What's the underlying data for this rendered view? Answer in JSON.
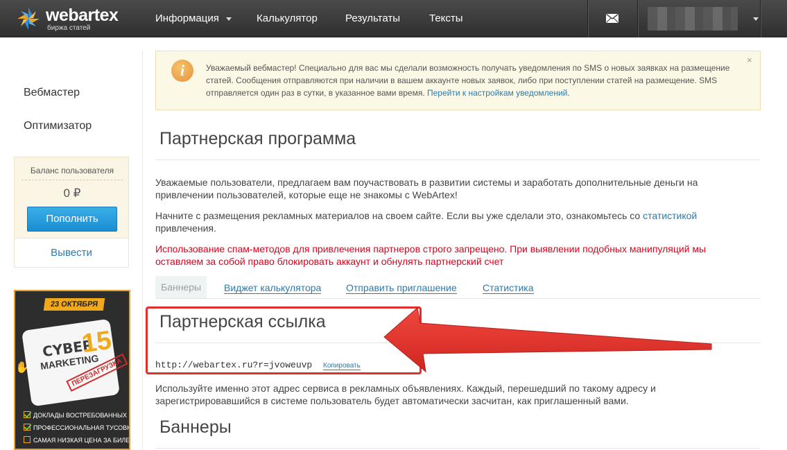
{
  "logo": {
    "name": "webartex",
    "tagline": "биржа статей"
  },
  "nav": {
    "items": [
      {
        "label": "Информация",
        "has_dropdown": true
      },
      {
        "label": "Калькулятор"
      },
      {
        "label": "Результаты"
      },
      {
        "label": "Тексты"
      }
    ],
    "mail_icon": "mail-icon",
    "user_menu_icon": "chevron-down-icon"
  },
  "sidebar": {
    "links": [
      "Вебмастер",
      "Оптимизатор"
    ],
    "balance": {
      "label": "Баланс пользователя",
      "value": "0 ₽",
      "topup_label": "Пополнить",
      "withdraw_label": "Вывести"
    },
    "ad": {
      "date": "23 ОКТЯБРЯ",
      "title_line1": "CYBER",
      "title_number": "15",
      "title_line2": "MARKETING",
      "stamp": "ПЕРЕЗАГРУЗКА",
      "features": [
        {
          "label": "ДОКЛАДЫ ВОСТРЕБОВАННЫХ ПРОФИ",
          "checked": true
        },
        {
          "label": "ПРОФЕССИОНАЛЬНАЯ ТУСОВКА",
          "checked": true
        },
        {
          "label": "САМАЯ НИЗКАЯ ЦЕНА ЗА БИЛЕТ",
          "checked": false
        }
      ]
    }
  },
  "notice": {
    "icon": "info-icon",
    "text": "Уважаемый вебмастер! Специально для вас мы сделали возможность получать уведомления по SMS о новых заявках на размещение статей. Сообщения отправляются при наличии в вашем аккаунте новых заявок, либо при поступлении статей на размещение. SMS отправляется один раз в сутки, в указанное вами время. ",
    "link": "Перейти к настройкам уведомлений",
    "link_suffix": ".",
    "close": "×"
  },
  "main": {
    "title": "Партнерская программа",
    "intro": "Уважаемые пользователи, предлагаем вам поучаствовать в развитии системы и заработать дополнительные деньги на привлечении пользователей, которые еще не знакомы с WebArtex!",
    "start_prefix": "Начните с размещения рекламных материалов на своем сайте. Если вы уже сделали это, ознакомьтесь со ",
    "start_link": "статистикой",
    "start_suffix": " привлечения.",
    "warning": "Использование спам-методов для привлечения партнеров строго запрещено. При выявлении подобных манипуляций мы оставляем за собой право блокировать аккаунт и обнулять партнерский счет",
    "tabs": [
      {
        "label": "Баннеры",
        "active": true
      },
      {
        "label": "Виджет калькулятора",
        "active": false
      },
      {
        "label": "Отправить приглашение",
        "active": false
      },
      {
        "label": "Статистика",
        "active": false
      }
    ],
    "ref_title": "Партнерская ссылка",
    "ref_url": "http://webartex.ru?r=jvoweuvp",
    "copy_label": "Копировать",
    "ref_note": "Используйте именно этот адрес сервиса в рекламных объявлениях. Каждый, перешедший по такому адресу и зарегистрировавшийся в системе пользователь будет автоматически засчитан, как приглашенный вами.",
    "banners_title": "Баннеры"
  },
  "colors": {
    "accent": "#2a7ab0",
    "warning": "#e0001b",
    "annotation": "#e0302b",
    "button": "#1b8ed3"
  }
}
